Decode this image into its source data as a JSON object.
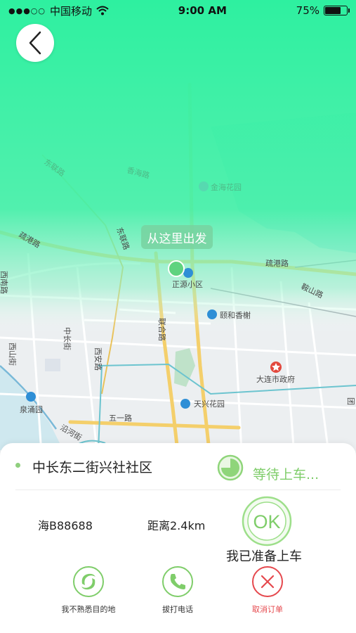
{
  "status_bar": {
    "signal": "●●●○○",
    "carrier": "中国移动",
    "time": "9:00 AM",
    "battery": "75%",
    "battery_level": 0.75
  },
  "map": {
    "start_tag": "从这里出发",
    "labels": [
      {
        "name": "东联路-top",
        "text": "东联路"
      },
      {
        "name": "香海路",
        "text": "香海路"
      },
      {
        "name": "金海花园",
        "text": "金海花园"
      },
      {
        "name": "疏港路-left",
        "text": "疏港路"
      },
      {
        "name": "东联路",
        "text": "东联路"
      },
      {
        "name": "正源小区",
        "text": "正源小区"
      },
      {
        "name": "疏港路-right",
        "text": "疏港路"
      },
      {
        "name": "西南路",
        "text": "西南路"
      },
      {
        "name": "颐和香榭",
        "text": "颐和香榭"
      },
      {
        "name": "鞍山路",
        "text": "鞍山路"
      },
      {
        "name": "联合路",
        "text": "联合路"
      },
      {
        "name": "中长街",
        "text": "中长街"
      },
      {
        "name": "西山街",
        "text": "西山街"
      },
      {
        "name": "西安路",
        "text": "西安路"
      },
      {
        "name": "大连市政府",
        "text": "大连市政府"
      },
      {
        "name": "泉涌园",
        "text": "泉涌园"
      },
      {
        "name": "天兴花园",
        "text": "天兴花园"
      },
      {
        "name": "五一路",
        "text": "五一路"
      },
      {
        "name": "沿河街",
        "text": "沿河街"
      },
      {
        "name": "团",
        "text": "团"
      }
    ]
  },
  "trip": {
    "destination": "中长东二街兴社社区",
    "status": "等待上车...",
    "plate": "海B88688",
    "distance": "距离2.4km",
    "ok_label": "OK",
    "ready_label": "我已准备上车"
  },
  "actions": [
    {
      "label": "我不熟悉目的地"
    },
    {
      "label": "拔打电话"
    },
    {
      "label": "取消订单"
    }
  ],
  "colors": {
    "accent_green": "#7fcd6a",
    "gradient_top": "#2ef0a0",
    "cancel_red": "#e5484d"
  }
}
